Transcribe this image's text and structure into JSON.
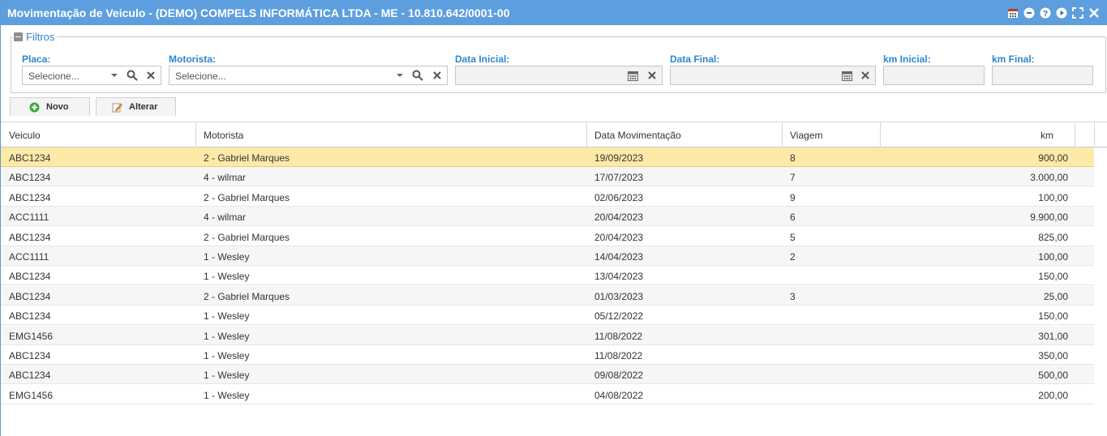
{
  "window": {
    "title": "Movimentação de Veiculo - (DEMO) COMPELS INFORMÁTICA LTDA - ME - 10.810.642/0001-00",
    "accent": "#5d9fde",
    "icons": [
      "calendar-icon",
      "minimize-icon",
      "help-icon",
      "play-icon",
      "maximize-icon",
      "close-icon"
    ]
  },
  "filters": {
    "legend": "Filtros",
    "placa": {
      "label": "Placa:",
      "placeholder": "Selecione..."
    },
    "motorista": {
      "label": "Motorista:",
      "placeholder": "Selecione..."
    },
    "data_inicial": {
      "label": "Data Inicial:",
      "value": ""
    },
    "data_final": {
      "label": "Data Final:",
      "value": ""
    },
    "km_inicial": {
      "label": "km Inicial:",
      "value": ""
    },
    "km_final": {
      "label": "km Final:",
      "value": ""
    }
  },
  "toolbar": {
    "novo_label": "Novo",
    "alterar_label": "Alterar"
  },
  "table": {
    "columns": [
      "Veiculo",
      "Motorista",
      "Data Movimentação",
      "Viagem",
      "km"
    ],
    "selected_row_color": "#fde9a8",
    "rows": [
      {
        "veiculo": "ABC1234",
        "motorista": "2 - Gabriel Marques",
        "data": "19/09/2023",
        "viagem": "8",
        "km": "900,00"
      },
      {
        "veiculo": "ABC1234",
        "motorista": "4 - wilmar",
        "data": "17/07/2023",
        "viagem": "7",
        "km": "3.000,00"
      },
      {
        "veiculo": "ABC1234",
        "motorista": "2 - Gabriel Marques",
        "data": "02/06/2023",
        "viagem": "9",
        "km": "100,00"
      },
      {
        "veiculo": "ACC1111",
        "motorista": "4 - wilmar",
        "data": "20/04/2023",
        "viagem": "6",
        "km": "9.900,00"
      },
      {
        "veiculo": "ABC1234",
        "motorista": "2 - Gabriel Marques",
        "data": "20/04/2023",
        "viagem": "5",
        "km": "825,00"
      },
      {
        "veiculo": "ACC1111",
        "motorista": "1 - Wesley",
        "data": "14/04/2023",
        "viagem": "2",
        "km": "100,00"
      },
      {
        "veiculo": "ABC1234",
        "motorista": "1 - Wesley",
        "data": "13/04/2023",
        "viagem": "",
        "km": "150,00"
      },
      {
        "veiculo": "ABC1234",
        "motorista": "2 - Gabriel Marques",
        "data": "01/03/2023",
        "viagem": "3",
        "km": "25,00"
      },
      {
        "veiculo": "ABC1234",
        "motorista": "1 - Wesley",
        "data": "05/12/2022",
        "viagem": "",
        "km": "150,00"
      },
      {
        "veiculo": "EMG1456",
        "motorista": "1 - Wesley",
        "data": "11/08/2022",
        "viagem": "",
        "km": "301,00"
      },
      {
        "veiculo": "ABC1234",
        "motorista": "1 - Wesley",
        "data": "11/08/2022",
        "viagem": "",
        "km": "350,00"
      },
      {
        "veiculo": "ABC1234",
        "motorista": "1 - Wesley",
        "data": "09/08/2022",
        "viagem": "",
        "km": "500,00"
      },
      {
        "veiculo": "EMG1456",
        "motorista": "1 - Wesley",
        "data": "04/08/2022",
        "viagem": "",
        "km": "200,00"
      }
    ]
  }
}
